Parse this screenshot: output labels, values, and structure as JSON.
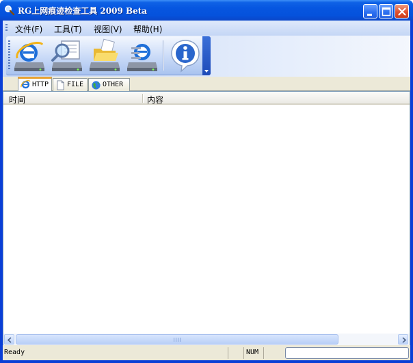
{
  "window": {
    "title": "RG上网痕迹检查工具 2009 Beta"
  },
  "menu": {
    "items": [
      {
        "label": "文件(F)"
      },
      {
        "label": "工具(T)"
      },
      {
        "label": "视图(V)"
      },
      {
        "label": "帮助(H)"
      }
    ]
  },
  "toolbar": {
    "buttons": [
      {
        "icon": "ie-drive-icon"
      },
      {
        "icon": "search-drive-icon"
      },
      {
        "icon": "folder-drive-icon"
      },
      {
        "icon": "doc-drive-icon"
      },
      {
        "icon": "info-icon"
      }
    ]
  },
  "tabs": [
    {
      "label": "HTTP",
      "icon": "ie-icon",
      "active": true
    },
    {
      "label": "FILE",
      "icon": "file-icon",
      "active": false
    },
    {
      "label": "OTHER",
      "icon": "globe-icon",
      "active": false
    }
  ],
  "list": {
    "columns": [
      "时间",
      "内容"
    ],
    "rows": []
  },
  "status": {
    "text": "Ready",
    "num": "NUM"
  },
  "colors": {
    "titlebar": "#0552dc",
    "tab_highlight": "#e8a233",
    "face": "#ece9d8"
  }
}
